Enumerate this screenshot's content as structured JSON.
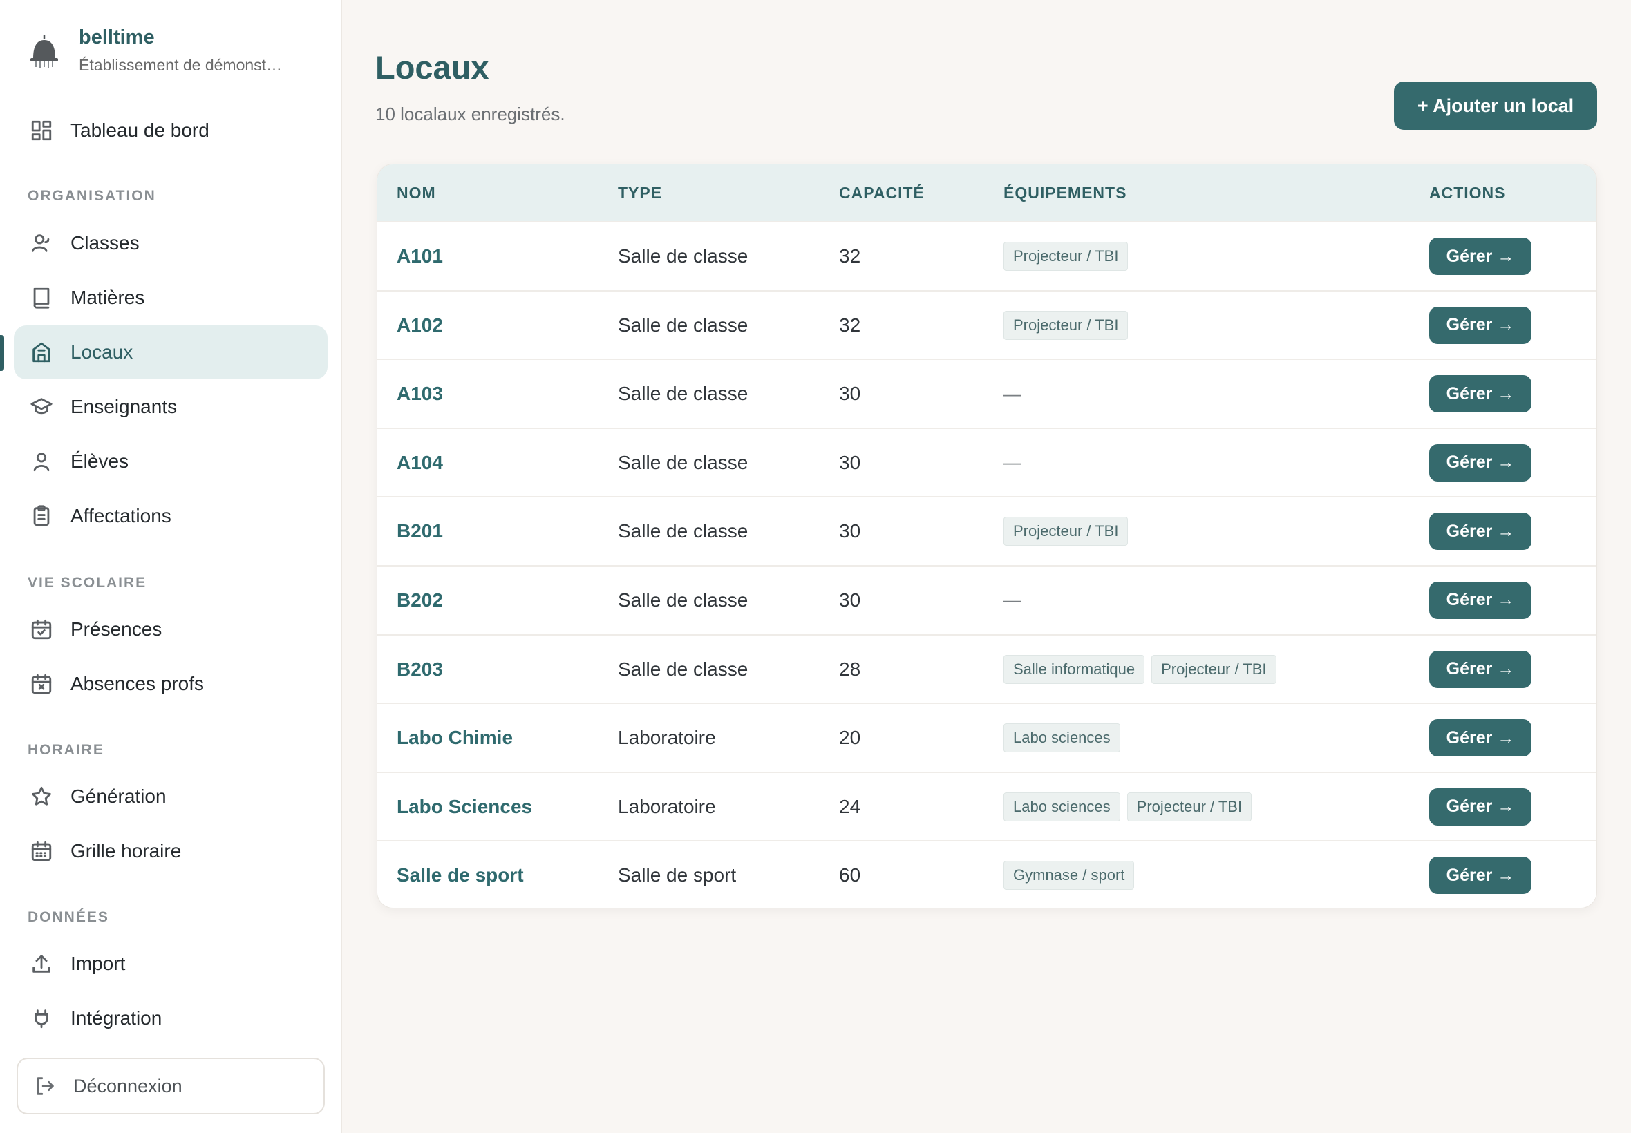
{
  "brand": {
    "name": "belltime",
    "subtitle": "Établissement de démonst…"
  },
  "sidebar": {
    "dashboard": "Tableau de bord",
    "sections": {
      "organisation": "ORGANISATION",
      "vie_scolaire": "VIE SCOLAIRE",
      "horaire": "HORAIRE",
      "donnees": "DONNÉES"
    },
    "items": {
      "classes": "Classes",
      "matieres": "Matières",
      "locaux": "Locaux",
      "enseignants": "Enseignants",
      "eleves": "Élèves",
      "affectations": "Affectations",
      "presences": "Présences",
      "absences": "Absences profs",
      "generation": "Génération",
      "grille": "Grille horaire",
      "import": "Import",
      "integration": "Intégration"
    },
    "active": "locaux",
    "logout": "Déconnexion"
  },
  "page": {
    "title": "Locaux",
    "subtitle": "10 localaux enregistrés.",
    "add_button": "+ Ajouter un local"
  },
  "table": {
    "headers": {
      "nom": "NOM",
      "type": "TYPE",
      "capacite": "CAPACITÉ",
      "equipements": "ÉQUIPEMENTS",
      "actions": "ACTIONS"
    },
    "action_label": "Gérer →",
    "empty_equipment": "—",
    "rows": [
      {
        "nom": "A101",
        "type": "Salle de classe",
        "capacite": "32",
        "equipements": [
          "Projecteur / TBI"
        ]
      },
      {
        "nom": "A102",
        "type": "Salle de classe",
        "capacite": "32",
        "equipements": [
          "Projecteur / TBI"
        ]
      },
      {
        "nom": "A103",
        "type": "Salle de classe",
        "capacite": "30",
        "equipements": []
      },
      {
        "nom": "A104",
        "type": "Salle de classe",
        "capacite": "30",
        "equipements": []
      },
      {
        "nom": "B201",
        "type": "Salle de classe",
        "capacite": "30",
        "equipements": [
          "Projecteur / TBI"
        ]
      },
      {
        "nom": "B202",
        "type": "Salle de classe",
        "capacite": "30",
        "equipements": []
      },
      {
        "nom": "B203",
        "type": "Salle de classe",
        "capacite": "28",
        "equipements": [
          "Salle informatique",
          "Projecteur / TBI"
        ]
      },
      {
        "nom": "Labo Chimie",
        "type": "Laboratoire",
        "capacite": "20",
        "equipements": [
          "Labo sciences"
        ]
      },
      {
        "nom": "Labo Sciences",
        "type": "Laboratoire",
        "capacite": "24",
        "equipements": [
          "Labo sciences",
          "Projecteur / TBI"
        ]
      },
      {
        "nom": "Salle de sport",
        "type": "Salle de sport",
        "capacite": "60",
        "equipements": [
          "Gymnase / sport"
        ]
      }
    ]
  },
  "colors": {
    "accent": "#356a6d",
    "accent_text": "#2f5f63",
    "active_bg": "#e3eeee",
    "header_bg": "#e7f0f0",
    "page_bg": "#f9f6f3"
  }
}
